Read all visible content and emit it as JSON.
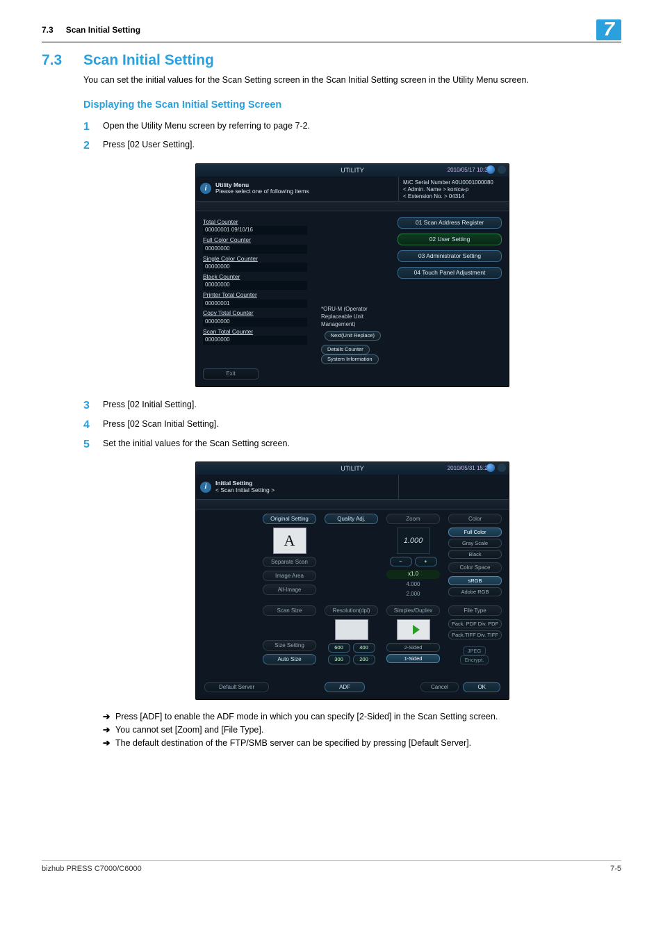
{
  "header": {
    "section_number": "7.3",
    "section_title": "Scan Initial Setting",
    "chapter_tab": "7"
  },
  "heading": {
    "number": "7.3",
    "title": "Scan Initial Setting"
  },
  "intro": "You can set the initial values for the Scan Setting screen in the Scan Initial Setting screen in the Utility Menu screen.",
  "sub_heading": "Displaying the Scan Initial Setting Screen",
  "steps": {
    "s1": "Open the Utility Menu screen by referring to page 7-2.",
    "s2": "Press [02 User Setting].",
    "s3": "Press [02 Initial Setting].",
    "s4": "Press [02 Scan Initial Setting].",
    "s5": "Set the initial values for the Scan Setting screen."
  },
  "notes": {
    "n1": "Press [ADF] to enable the ADF mode in which you can specify [2-Sided] in the Scan Setting screen.",
    "n2": "You cannot set [Zoom] and [File Type].",
    "n3": "The default destination of the FTP/SMB server can be specified by pressing [Default Server]."
  },
  "shot1": {
    "title": "UTILITY",
    "timestamp": "2010/05/17 10:38",
    "info_line1": "Utility Menu",
    "info_line2": "Please select one of following items",
    "meta_line1": "M/C Serial Number   A0U0001000080",
    "meta_line2": "< Admin. Name >   konica-p",
    "meta_line3": "< Extension No. >   04314",
    "counters": {
      "total_lbl": "Total Counter",
      "total_val": "00000001    09/10/16",
      "full_lbl": "Full Color Counter",
      "full_val": "00000000",
      "single_lbl": "Single Color Counter",
      "single_val": "00000000",
      "black_lbl": "Black Counter",
      "black_val": "00000000",
      "printer_lbl": "Printer Total Counter",
      "printer_val": "00000001",
      "copy_lbl": "Copy Total Counter",
      "copy_val": "00000000",
      "scan_lbl": "Scan Total Counter",
      "scan_val": "00000000"
    },
    "orum": "*ORU-M (Operator Replaceable Unit Management)",
    "btn_next": "Next(Unit Replace)",
    "btn_details": "Details Counter",
    "btn_sys": "System Information",
    "right_buttons": {
      "b1": "01 Scan Address Register",
      "b2": "02 User Setting",
      "b3": "03 Administrator Setting",
      "b4": "04 Touch Panel Adjustment"
    },
    "exit": "Exit"
  },
  "shot2": {
    "title": "UTILITY",
    "timestamp": "2010/05/31 15:24",
    "crumb1": "Initial Setting",
    "crumb2": "< Scan Initial Setting >",
    "heads": {
      "orig": "Original Setting",
      "quality": "Quality Adj.",
      "zoom": "Zoom",
      "color": "Color",
      "sep": "Separate Scan",
      "imgarea": "Image Area",
      "allimg": "All-Image",
      "scansize": "Scan Size",
      "res": "Resolution(dpi)",
      "simplex": "Simplex/Duplex",
      "filetype": "File Type",
      "sizeset": "Size Setting",
      "autosize": "Auto Size"
    },
    "vals": {
      "zoom_main": "1.000",
      "zoom_x1": "x1.0",
      "zoom_a": "4.000",
      "zoom_b": "2.000",
      "r600": "600",
      "r400": "400",
      "r300": "300",
      "r200": "200",
      "two_sided": "2-Sided",
      "one_sided": "1-Sided",
      "full_color": "Full Color",
      "gray": "Gray Scale",
      "black": "Black",
      "cspace": "Color Space",
      "srgb": "sRGB",
      "argb": "Adobe RGB",
      "pack_pdf": "Pack. PDF Div.  PDF",
      "pack_tiff": "Pack.TIFF Div. TIFF",
      "jpeg": "JPEG",
      "encrypt": "Encrypt."
    },
    "bottom": {
      "default_server": "Default Server",
      "adf": "ADF",
      "cancel": "Cancel",
      "ok": "OK"
    }
  },
  "footer": {
    "left": "bizhub PRESS C7000/C6000",
    "right": "7-5"
  }
}
